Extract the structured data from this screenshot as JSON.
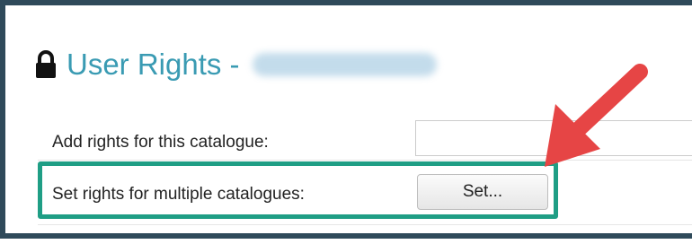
{
  "header": {
    "icon": "lock-icon",
    "title": "User Rights -"
  },
  "rows": [
    {
      "label": "Add rights for this catalogue:"
    },
    {
      "label": "Set rights for multiple catalogues:",
      "button_label": "Set..."
    }
  ],
  "annotations": {
    "highlight_color": "#1f9e85",
    "arrow_color": "#e64545"
  },
  "colors": {
    "title": "#3a9bb3",
    "frame": "#2f4a5a"
  }
}
